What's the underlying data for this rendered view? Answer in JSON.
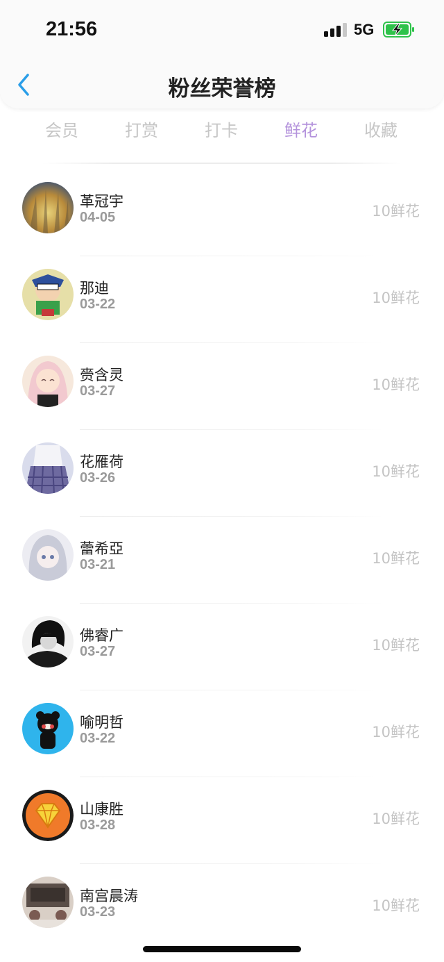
{
  "status_bar": {
    "time": "21:56",
    "network": "5G"
  },
  "nav": {
    "title": "粉丝荣誉榜"
  },
  "tabs": [
    {
      "label": "会员",
      "active": false
    },
    {
      "label": "打赏",
      "active": false
    },
    {
      "label": "打卡",
      "active": false
    },
    {
      "label": "鲜花",
      "active": true
    },
    {
      "label": "收藏",
      "active": false
    }
  ],
  "colors": {
    "active_tab": "#b493dc",
    "inactive_tab": "#c6c6c6",
    "amount": "#c4c4c4",
    "battery": "#2ec24a"
  },
  "fans": [
    {
      "name": "革冠宇",
      "date": "04-05",
      "amount": "10鲜花",
      "avatar": "forest-photo"
    },
    {
      "name": "那迪",
      "date": "03-22",
      "amount": "10鲜花",
      "avatar": "cartoon-character"
    },
    {
      "name": "赍含灵",
      "date": "03-27",
      "amount": "10鲜花",
      "avatar": "anime-girl-pink-hair"
    },
    {
      "name": "花雁荷",
      "date": "03-26",
      "amount": "10鲜花",
      "avatar": "plaid-skirt-photo"
    },
    {
      "name": "蕾希亞",
      "date": "03-21",
      "amount": "10鲜花",
      "avatar": "anime-girl-silver-hair"
    },
    {
      "name": "佛睿广",
      "date": "03-27",
      "amount": "10鲜花",
      "avatar": "black-white-portrait"
    },
    {
      "name": "喻明哲",
      "date": "03-22",
      "amount": "10鲜花",
      "avatar": "kumamon-blue"
    },
    {
      "name": "山康胜",
      "date": "03-28",
      "amount": "10鲜花",
      "avatar": "orange-diamond-badge"
    },
    {
      "name": "南宫晨涛",
      "date": "03-23",
      "amount": "10鲜花",
      "avatar": "vintage-photo"
    }
  ]
}
